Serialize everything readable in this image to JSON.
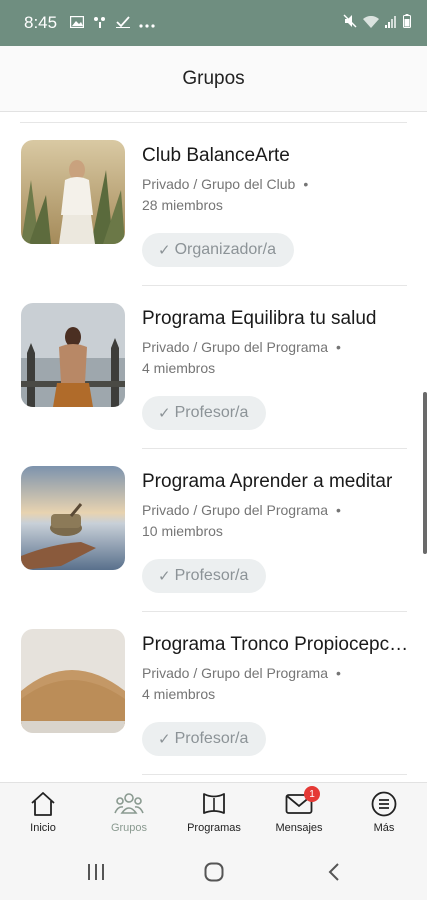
{
  "status_bar": {
    "time": "8:45",
    "icons_left": [
      "image-icon",
      "network-icon",
      "check-icon",
      "more-icon"
    ],
    "icons_right": [
      "mute-icon",
      "wifi-icon",
      "signal-icon",
      "battery-icon"
    ]
  },
  "header": {
    "title": "Grupos"
  },
  "groups": [
    {
      "name": "Club BalanceArte",
      "meta": "Privado / Grupo del Club",
      "members": "28 miembros",
      "role": "Organizador/a",
      "image": "woman-plants-photo"
    },
    {
      "name": "Programa Equilibra tu salud",
      "meta": "Privado / Grupo del Programa",
      "members": "4 miembros",
      "role": "Profesor/a",
      "image": "woman-temple-photo"
    },
    {
      "name": "Programa Aprender a meditar",
      "meta": "Privado / Grupo del Programa",
      "members": "10 miembros",
      "role": "Profesor/a",
      "image": "singing-bowl-photo"
    },
    {
      "name": "Programa Tronco Propiocepción",
      "meta": "Privado / Grupo del Programa",
      "members": "4 miembros",
      "role": "Profesor/a",
      "image": "wooden-block-photo"
    }
  ],
  "bottom_nav": {
    "items": [
      {
        "label": "Inicio",
        "icon": "home-icon"
      },
      {
        "label": "Grupos",
        "icon": "groups-icon",
        "active": true
      },
      {
        "label": "Programas",
        "icon": "programs-icon"
      },
      {
        "label": "Mensajes",
        "icon": "mail-icon",
        "badge": "1"
      },
      {
        "label": "Más",
        "icon": "menu-icon"
      }
    ]
  },
  "colors": {
    "status_bar": "#6f8e80",
    "active_nav": "#8a9a90",
    "badge": "#e53935",
    "role_badge_bg": "#eceff0",
    "role_badge_text": "#8c9397"
  }
}
